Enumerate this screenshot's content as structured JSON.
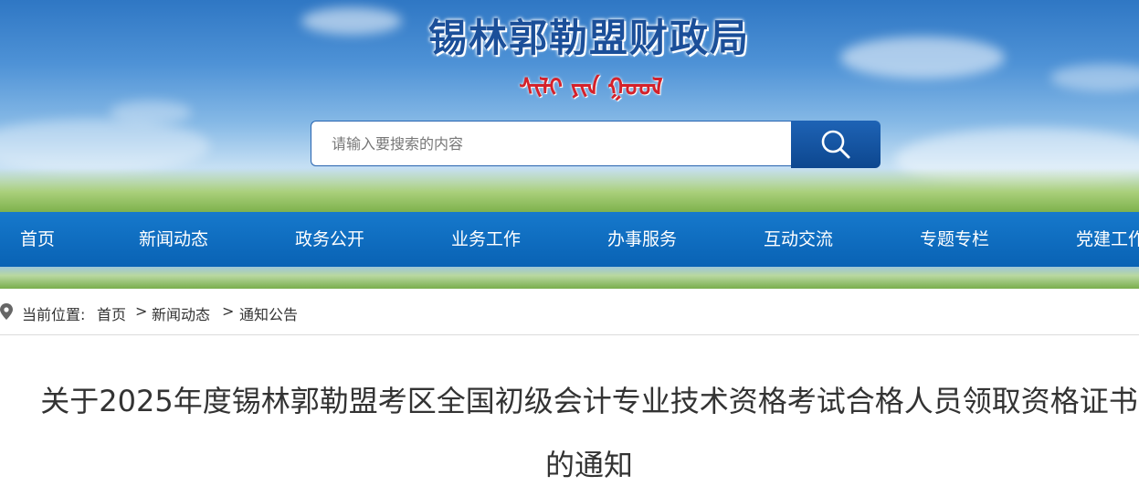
{
  "header": {
    "site_title": "锡林郭勒盟财政局",
    "site_title_mongolian": "ᠰᠢᠯᠢ ᠶᠢᠨ ᠭᠣᠣᠯ"
  },
  "search": {
    "placeholder": "请输入要搜索的内容",
    "value": ""
  },
  "nav": {
    "items": [
      {
        "label": "首页"
      },
      {
        "label": "新闻动态"
      },
      {
        "label": "政务公开"
      },
      {
        "label": "业务工作"
      },
      {
        "label": "办事服务"
      },
      {
        "label": "互动交流"
      },
      {
        "label": "专题专栏"
      },
      {
        "label": "党建工作"
      }
    ]
  },
  "breadcrumb": {
    "prefix": "当前位置:",
    "items": [
      "首页",
      "新闻动态",
      "通知公告"
    ],
    "separator": ">"
  },
  "article": {
    "title_line1": "关于2025年度锡林郭勒盟考区全国初级会计专业技术资格考试合格人员领取资格证书",
    "title_line2": "的通知"
  },
  "colors": {
    "nav_bg": "#0a68bb",
    "title_blue": "#1b4f99",
    "mongolian_red": "#d4222b",
    "search_button": "#0d478f"
  },
  "icons": {
    "search_button": "magnifier-icon",
    "breadcrumb": "location-pin-icon"
  }
}
